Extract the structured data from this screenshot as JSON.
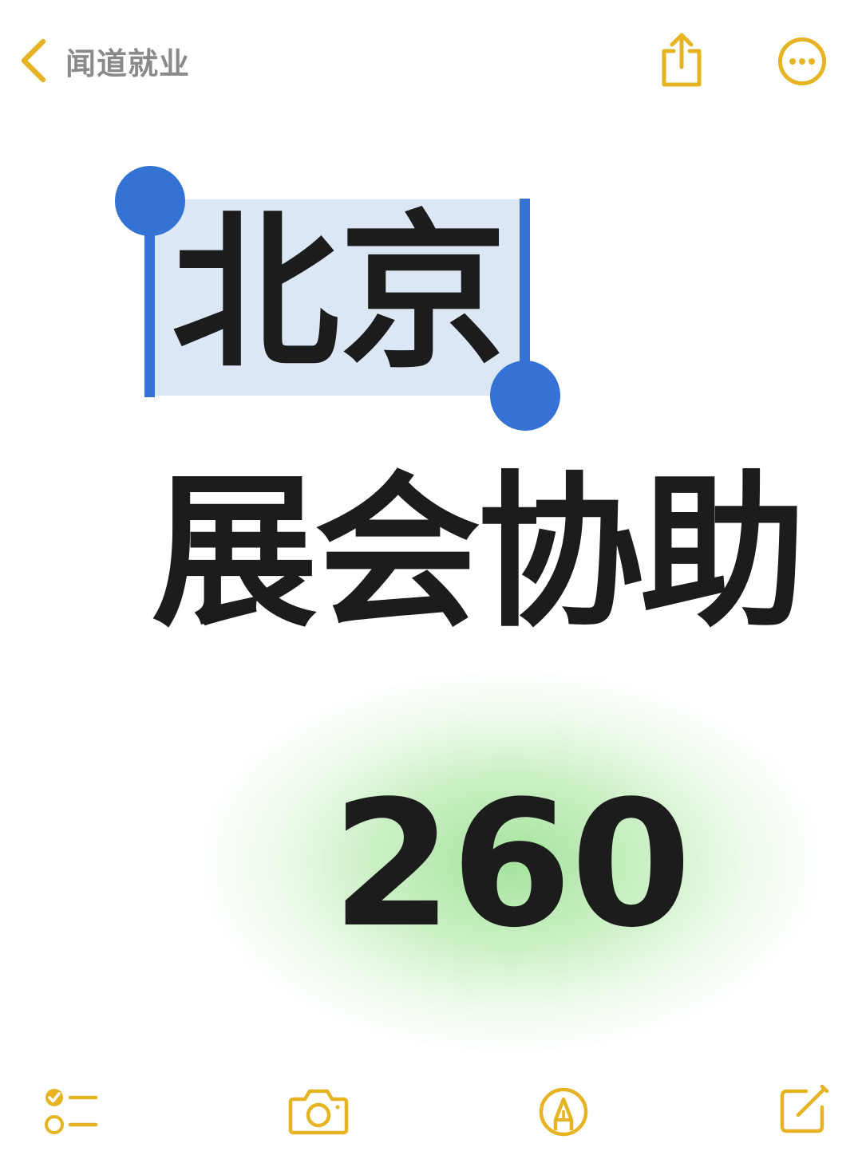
{
  "header": {
    "back_label": "闻道就业",
    "back_icon": "chevron-left-icon",
    "share_icon": "share-icon",
    "more_icon": "ellipsis-circle-icon"
  },
  "note": {
    "title_selected": "北京",
    "title_line2": "展会协助",
    "number": "260"
  },
  "toolbar": {
    "icons": [
      "checklist-icon",
      "camera-icon",
      "markup-pen-icon",
      "compose-icon"
    ]
  },
  "colors": {
    "accent": "#E6B422",
    "selection_fill": "#DCE7F6",
    "selection_handle": "#3472D4",
    "text": "#1C1C1C",
    "back_label": "#8A8A8A",
    "glow": "#96DE8C"
  }
}
